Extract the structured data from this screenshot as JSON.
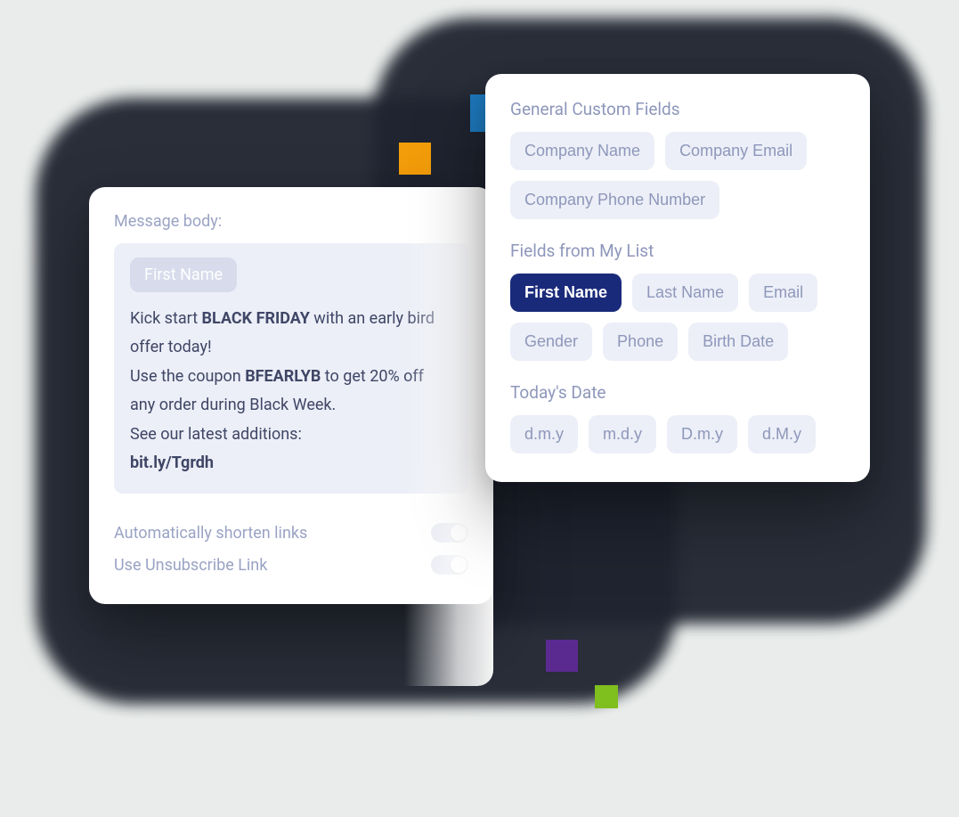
{
  "message": {
    "label": "Message body:",
    "inserted_field_chip": "First Name",
    "text_before_bf": "Kick start ",
    "bf": "BLACK FRIDAY",
    "text_after_bf": " with an early bird offer today!",
    "line2_before": "Use the coupon ",
    "coupon": "BFEARLYB",
    "line2_after": " to get 20% off any order during Black Week.",
    "line3": "See our latest additions:",
    "link": "bit.ly/Tgrdh"
  },
  "toggles": {
    "shorten_label": "Automatically shorten links",
    "unsubscribe_label": "Use Unsubscribe Link"
  },
  "fields": {
    "general_title": "General Custom Fields",
    "general": [
      "Company Name",
      "Company Email",
      "Company Phone Number"
    ],
    "mylist_title": "Fields from My List",
    "mylist": [
      "First Name",
      "Last Name",
      "Email",
      "Gender",
      "Phone",
      "Birth Date"
    ],
    "date_title": "Today's Date",
    "date": [
      "d.m.y",
      "m.d.y",
      "D.m.y",
      "d.M.y"
    ]
  }
}
